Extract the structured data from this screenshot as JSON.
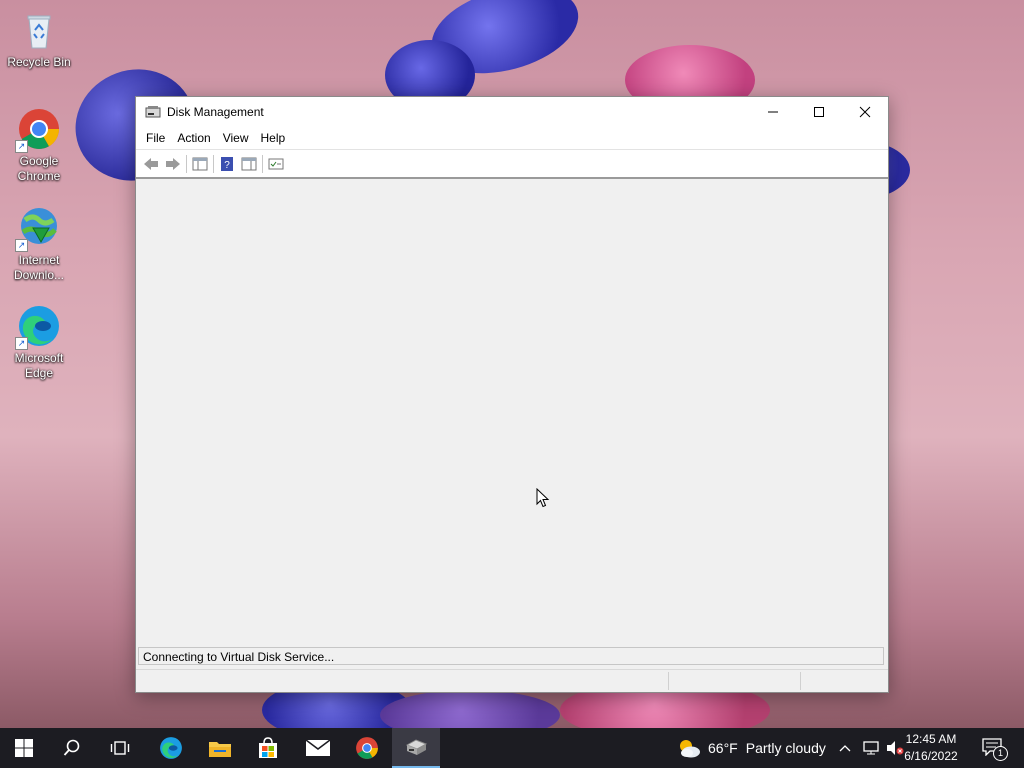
{
  "desktop": {
    "icons": [
      {
        "label": "Recycle Bin",
        "icon": "recycle-bin-icon"
      },
      {
        "label": "Google Chrome",
        "icon": "chrome-icon"
      },
      {
        "label": "Internet Downlo...",
        "icon": "internet-download-manager-icon"
      },
      {
        "label": "Microsoft Edge",
        "icon": "edge-icon"
      }
    ],
    "icon_labels_split": [
      [
        "Recycle Bin"
      ],
      [
        "Google",
        "Chrome"
      ],
      [
        "Internet",
        "Downlo..."
      ],
      [
        "Microsoft",
        "Edge"
      ]
    ]
  },
  "window": {
    "title": "Disk Management",
    "menu": [
      "File",
      "Action",
      "View",
      "Help"
    ],
    "toolbar": [
      "back-icon",
      "forward-icon",
      "show-hide-console-tree-icon",
      "help-icon",
      "show-hide-action-pane-icon",
      "properties-icon"
    ],
    "status_text": "Connecting to Virtual Disk Service..."
  },
  "taskbar": {
    "apps": [
      "start-icon",
      "search-icon",
      "task-view-icon",
      "edge-icon",
      "file-explorer-icon",
      "microsoft-store-icon",
      "mail-icon",
      "chrome-icon",
      "disk-management-icon"
    ],
    "weather": {
      "temp": "66°F",
      "condition": "Partly cloudy"
    },
    "clock": {
      "time": "12:45 AM",
      "date": "6/16/2022"
    },
    "notification_count": "1"
  },
  "colors": {
    "accent": "#76b9ed",
    "taskbar": "#1c1c22"
  }
}
